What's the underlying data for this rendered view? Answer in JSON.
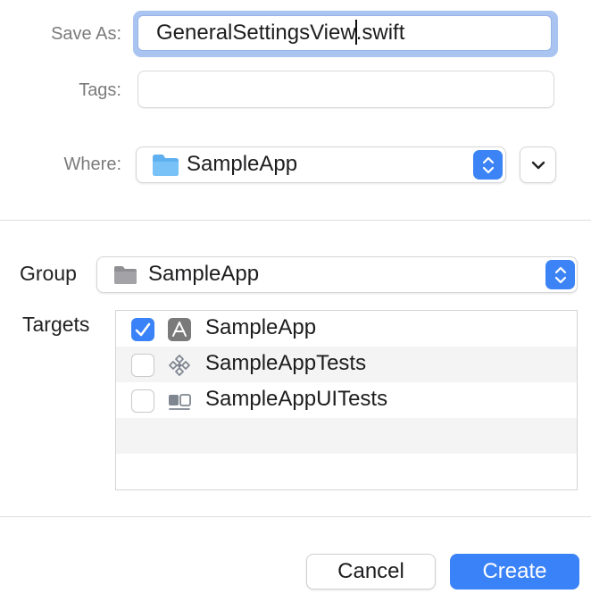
{
  "form": {
    "save_as_label": "Save As:",
    "file_name_before_caret": "GeneralSettingsView",
    "file_name_after_caret": ".swift",
    "tags_label": "Tags:",
    "tags_value": "",
    "where_label": "Where:",
    "where_value": "SampleApp"
  },
  "project": {
    "group_label": "Group",
    "group_value": "SampleApp",
    "targets_label": "Targets",
    "targets": [
      {
        "label": "SampleApp",
        "checked": true,
        "icon": "app-store-icon"
      },
      {
        "label": "SampleAppTests",
        "checked": false,
        "icon": "unit-test-diamond-icon"
      },
      {
        "label": "SampleAppUITests",
        "checked": false,
        "icon": "ui-test-icon"
      }
    ]
  },
  "buttons": {
    "cancel": "Cancel",
    "create": "Create"
  },
  "colors": {
    "accent": "#3a82f7",
    "focus_ring": "#a9c4f1",
    "folder_blue": "#5fb0f0"
  }
}
